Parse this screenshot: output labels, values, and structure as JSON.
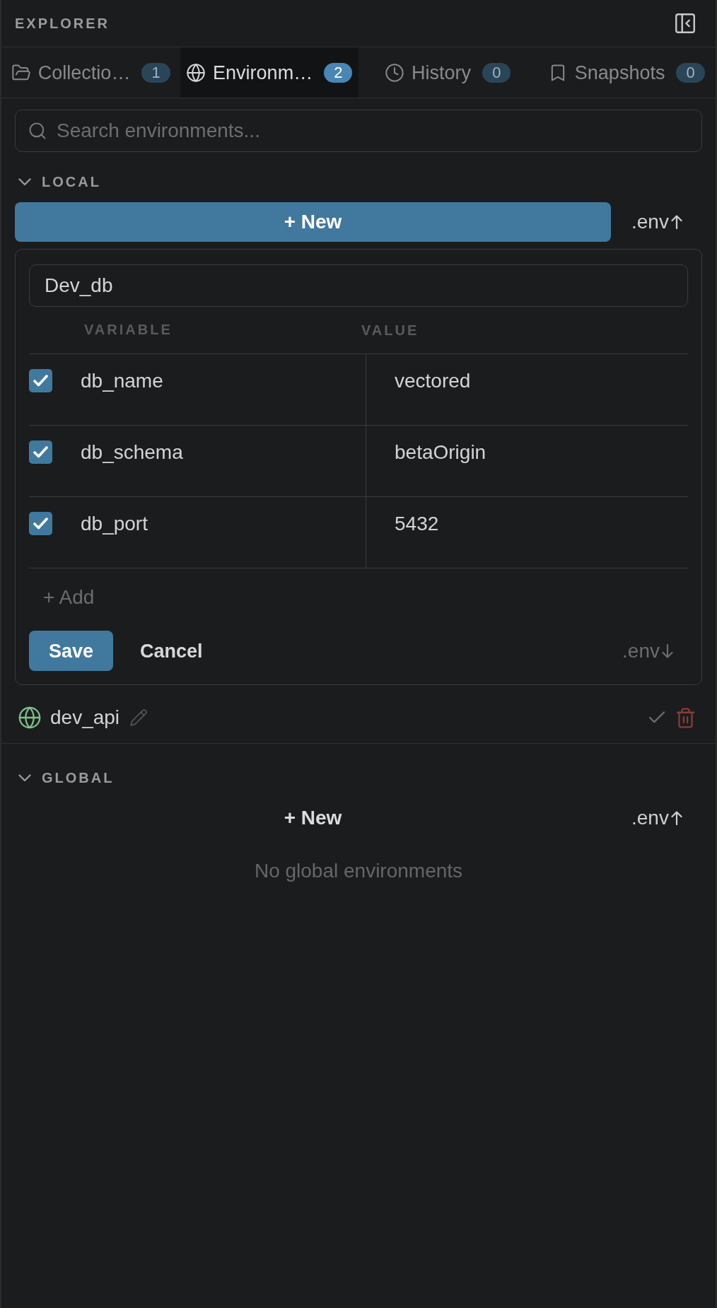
{
  "header": {
    "title": "EXPLORER"
  },
  "tabs": [
    {
      "label": "Collectio…",
      "count": "1",
      "selected": false
    },
    {
      "label": "Environm…",
      "count": "2",
      "selected": true
    },
    {
      "label": "History",
      "count": "0",
      "selected": false
    },
    {
      "label": "Snapshots",
      "count": "0",
      "selected": false
    }
  ],
  "search": {
    "placeholder": "Search environments..."
  },
  "sections": [
    {
      "title": "LOCAL",
      "expanded": true,
      "new_button": {
        "label": "+ New",
        "highlighted": true
      },
      "env_button": {
        "label": ".env"
      },
      "editor": {
        "name": "Dev_db",
        "columns": [
          "VARIABLE",
          "VALUE"
        ],
        "variables": [
          {
            "name": "db_name",
            "value": "vectored",
            "enabled": true
          },
          {
            "name": "db_schema",
            "value": "betaOrigin",
            "enabled": true
          },
          {
            "name": "db_port",
            "value": "5432",
            "enabled": true
          }
        ],
        "add_label": "+ Add",
        "save_label": "Save",
        "cancel_label": "Cancel",
        "env_label": ".env"
      },
      "environments": [
        {
          "name": "dev_api"
        }
      ]
    },
    {
      "title": "GLOBAL",
      "expanded": true,
      "new_button": {
        "label": "+ New",
        "highlighted": false
      },
      "env_button": {
        "label": ".env"
      },
      "empty_text": "No global environments"
    }
  ]
}
